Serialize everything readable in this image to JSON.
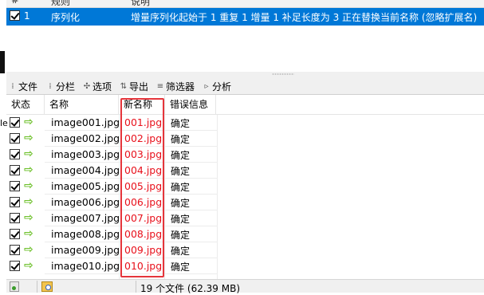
{
  "rules": {
    "columns": [
      "#",
      "规则",
      "说明"
    ],
    "row": {
      "checked": true,
      "number": "1",
      "name": "序列化",
      "description": "增量序列化起始于 1 重复 1 增量 1 补足长度为 3 正在替换当前名称 (忽略扩展名)"
    }
  },
  "left_edge_text": "le",
  "toolbar": {
    "file": "文件",
    "columns": "分栏",
    "options": "选项",
    "export": "导出",
    "filter": "筛选器",
    "analyze": "分析"
  },
  "file_table": {
    "headers": [
      "状态",
      "名称",
      "新名称",
      "错误信息"
    ],
    "rows": [
      {
        "name": "image001.jpg",
        "new_name": "001.jpg",
        "error": "确定"
      },
      {
        "name": "image002.jpg",
        "new_name": "002.jpg",
        "error": "确定"
      },
      {
        "name": "image003.jpg",
        "new_name": "003.jpg",
        "error": "确定"
      },
      {
        "name": "image004.jpg",
        "new_name": "004.jpg",
        "error": "确定"
      },
      {
        "name": "image005.jpg",
        "new_name": "005.jpg",
        "error": "确定"
      },
      {
        "name": "image006.jpg",
        "new_name": "006.jpg",
        "error": "确定"
      },
      {
        "name": "image007.jpg",
        "new_name": "007.jpg",
        "error": "确定"
      },
      {
        "name": "image008.jpg",
        "new_name": "008.jpg",
        "error": "确定"
      },
      {
        "name": "image009.jpg",
        "new_name": "009.jpg",
        "error": "确定"
      },
      {
        "name": "image010.jpg",
        "new_name": "010.jpg",
        "error": "确定"
      }
    ]
  },
  "status_bar": {
    "summary": "19 个文件 (62.39 MB)"
  },
  "colors": {
    "selection": "#0078d7",
    "new_name_text": "#e8101b",
    "highlight_box": "#e5353b",
    "ok_arrow": "#6abf26"
  }
}
